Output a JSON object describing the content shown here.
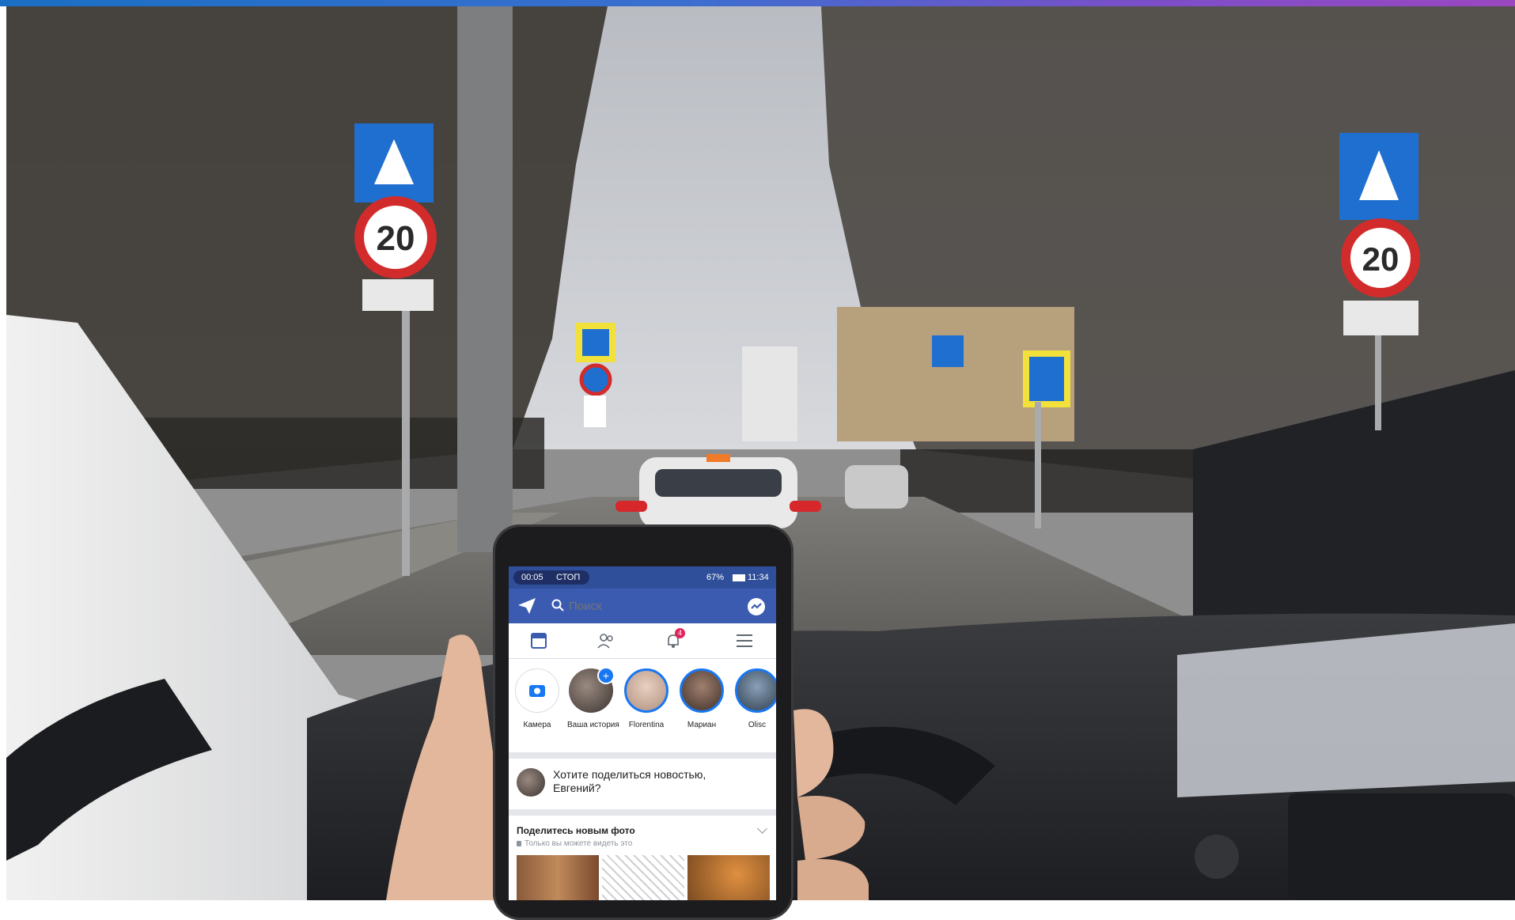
{
  "phone": {
    "status": {
      "timer": "00:05",
      "stop_label": "СТОП",
      "battery": "67%",
      "time": "11:34"
    },
    "search": {
      "placeholder": "Поиск"
    },
    "notifications": {
      "count": "4"
    },
    "stories": [
      {
        "label": "Камера"
      },
      {
        "label": "Ваша история"
      },
      {
        "label": "Florentina"
      },
      {
        "label": "Мариан"
      },
      {
        "label": "Olisc"
      }
    ],
    "composer": {
      "prompt_line1": "Хотите поделиться новостью,",
      "prompt_line2": "Евгений?"
    },
    "share_photo": {
      "title": "Поделитесь новым фото",
      "subtitle": "Только вы можете видеть это"
    }
  },
  "road_signs": {
    "speed_limit_left": "20",
    "speed_limit_right": "20"
  },
  "colors": {
    "top_gradient_start": "#1a6fc4",
    "top_gradient_end": "#9b47c0",
    "fb_header": "#3b5bb0",
    "fb_status": "#2f4f9a",
    "notification_badge": "#e0245e"
  }
}
